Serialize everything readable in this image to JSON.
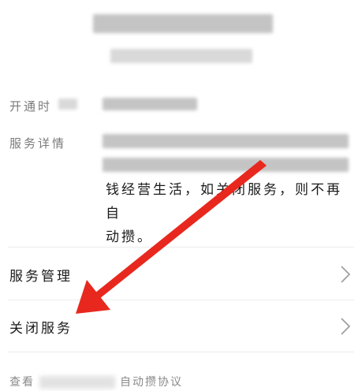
{
  "info": {
    "open_label": "开通时",
    "details_label": "服务详情",
    "details_text_line1": "钱经营生活，如关闭服务，则不再自",
    "details_text_line2": "动攒。"
  },
  "menu": {
    "manage_label": "服务管理",
    "close_label": "关闭服务"
  },
  "footer": {
    "prefix": "查看",
    "suffix": "自动攒协议"
  },
  "annotation": {
    "arrow_color": "#e8281e"
  }
}
